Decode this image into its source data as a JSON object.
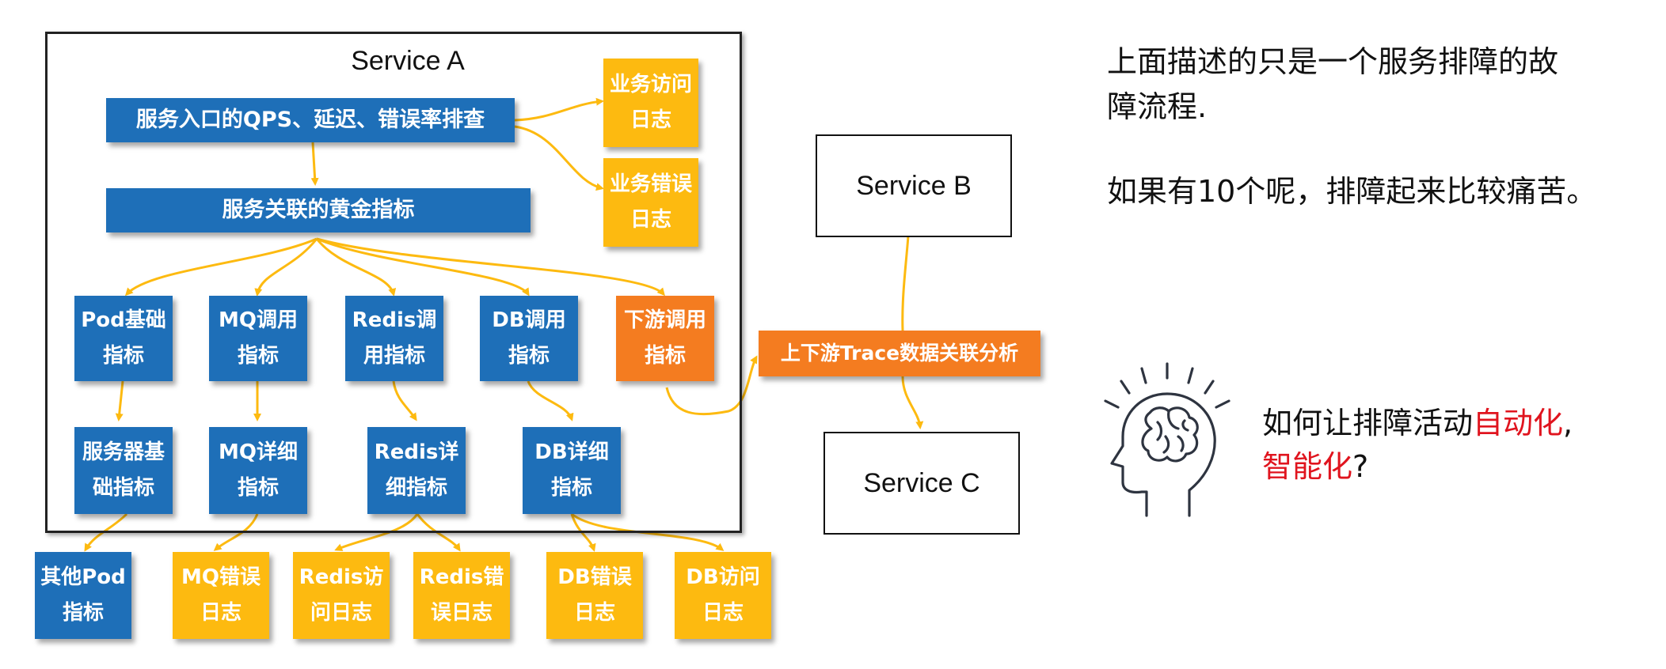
{
  "service_a": {
    "title": "Service A",
    "entry": "服务入口的QPS、延迟、错误率排查",
    "golden": "服务关联的黄金指标",
    "access_log": [
      "业务访问",
      "日志"
    ],
    "error_log": [
      "业务错误",
      "日志"
    ],
    "metrics": [
      [
        "Pod基础",
        "指标"
      ],
      [
        "MQ调用",
        "指标"
      ],
      [
        "Redis调",
        "用指标"
      ],
      [
        "DB调用",
        "指标"
      ],
      [
        "下游调用",
        "指标"
      ]
    ],
    "details": [
      [
        "服务器基",
        "础指标"
      ],
      [
        "MQ详细",
        "指标"
      ],
      [
        "Redis详",
        "细指标"
      ],
      [
        "DB详细",
        "指标"
      ]
    ]
  },
  "logs": [
    [
      "其他Pod",
      "指标"
    ],
    [
      "MQ错误",
      "日志"
    ],
    [
      "Redis访",
      "问日志"
    ],
    [
      "Redis错",
      "误日志"
    ],
    [
      "DB错误",
      "日志"
    ],
    [
      "DB访问",
      "日志"
    ]
  ],
  "trace": "上下游Trace数据关联分析",
  "service_b": "Service B",
  "service_c": "Service C",
  "notes": {
    "line1": "上面描述的只是一个服务排障的故",
    "line2": "障流程.",
    "line3": "如果有10个呢，排障起来比较痛苦。",
    "q_prefix": "如何让排障活动",
    "q_red1": "自动化",
    "q_comma": ",",
    "q_red2": "智能化",
    "q_suffix": "?"
  },
  "colors": {
    "blue": "#1E6FB8",
    "yellow": "#FDBA10",
    "orange": "#F47C20",
    "arrow": "#FDBA10",
    "highlight": "#E0141E"
  },
  "icons": [
    "brain-head-icon"
  ]
}
